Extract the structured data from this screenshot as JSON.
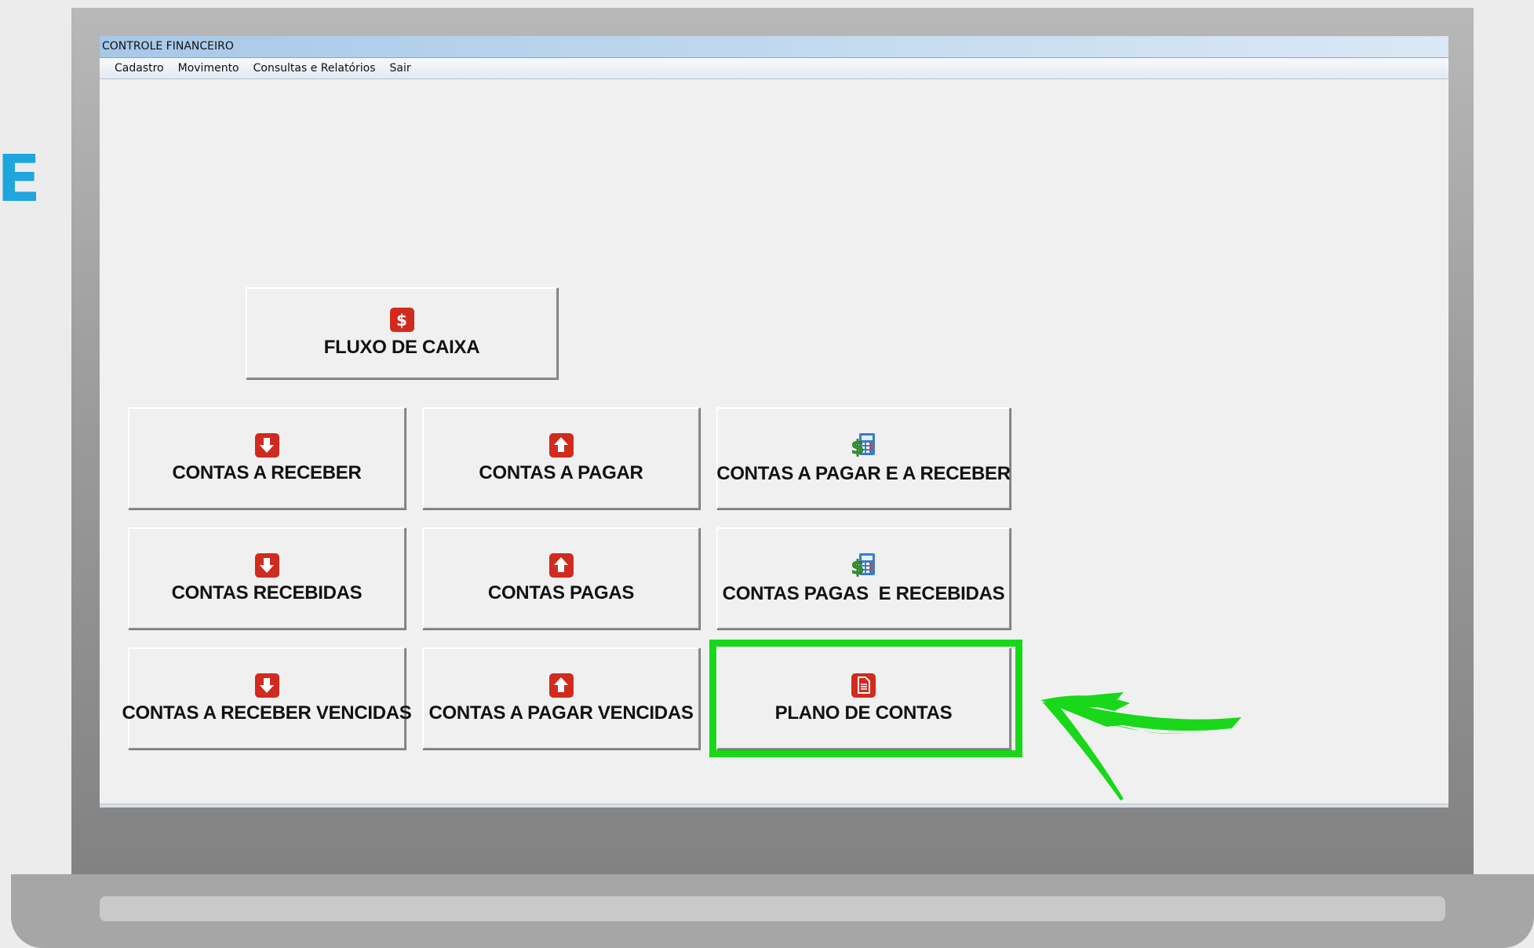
{
  "edge_text": "E",
  "window": {
    "title": "CONTROLE FINANCEIRO",
    "menu": [
      "Cadastro",
      "Movimento",
      "Consultas e Relatórios",
      "Sair"
    ]
  },
  "buttons": {
    "fluxo_de_caixa": "FLUXO DE CAIXA",
    "contas_a_receber": "CONTAS A RECEBER",
    "contas_a_pagar": "CONTAS A PAGAR",
    "contas_a_pagar_e_a_receber": "CONTAS A PAGAR E A RECEBER",
    "contas_recebidas": "CONTAS RECEBIDAS",
    "contas_pagas": "CONTAS PAGAS",
    "contas_pagas_e_recebidas": "CONTAS PAGAS  E RECEBIDAS",
    "contas_a_receber_vencidas": "CONTAS A RECEBER VENCIDAS",
    "contas_a_pagar_vencidas": "CONTAS A PAGAR VENCIDAS",
    "plano_de_contas": "PLANO DE CONTAS"
  },
  "icons": {
    "dollar": "dollar-icon",
    "down": "arrow-down-icon",
    "up": "arrow-up-icon",
    "calculator": "calculator-money-icon",
    "document": "document-icon"
  },
  "colors": {
    "icon_red": "#d12a1e",
    "highlight_green": "#18d819",
    "edge_blue": "#1ea6dd"
  }
}
